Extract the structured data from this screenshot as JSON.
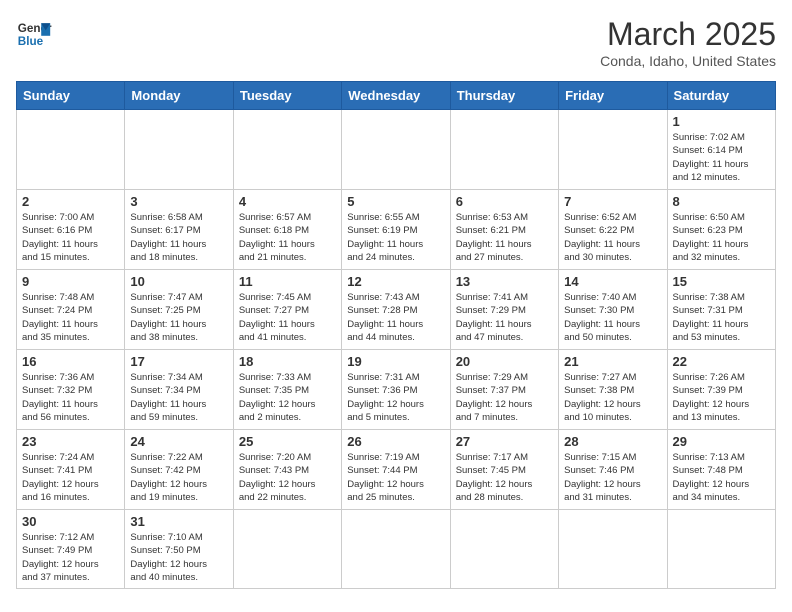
{
  "header": {
    "logo_line1": "General",
    "logo_line2": "Blue",
    "month_title": "March 2025",
    "location": "Conda, Idaho, United States"
  },
  "weekdays": [
    "Sunday",
    "Monday",
    "Tuesday",
    "Wednesday",
    "Thursday",
    "Friday",
    "Saturday"
  ],
  "weeks": [
    [
      {
        "day": "",
        "info": ""
      },
      {
        "day": "",
        "info": ""
      },
      {
        "day": "",
        "info": ""
      },
      {
        "day": "",
        "info": ""
      },
      {
        "day": "",
        "info": ""
      },
      {
        "day": "",
        "info": ""
      },
      {
        "day": "1",
        "info": "Sunrise: 7:02 AM\nSunset: 6:14 PM\nDaylight: 11 hours\nand 12 minutes."
      }
    ],
    [
      {
        "day": "2",
        "info": "Sunrise: 7:00 AM\nSunset: 6:16 PM\nDaylight: 11 hours\nand 15 minutes."
      },
      {
        "day": "3",
        "info": "Sunrise: 6:58 AM\nSunset: 6:17 PM\nDaylight: 11 hours\nand 18 minutes."
      },
      {
        "day": "4",
        "info": "Sunrise: 6:57 AM\nSunset: 6:18 PM\nDaylight: 11 hours\nand 21 minutes."
      },
      {
        "day": "5",
        "info": "Sunrise: 6:55 AM\nSunset: 6:19 PM\nDaylight: 11 hours\nand 24 minutes."
      },
      {
        "day": "6",
        "info": "Sunrise: 6:53 AM\nSunset: 6:21 PM\nDaylight: 11 hours\nand 27 minutes."
      },
      {
        "day": "7",
        "info": "Sunrise: 6:52 AM\nSunset: 6:22 PM\nDaylight: 11 hours\nand 30 minutes."
      },
      {
        "day": "8",
        "info": "Sunrise: 6:50 AM\nSunset: 6:23 PM\nDaylight: 11 hours\nand 32 minutes."
      }
    ],
    [
      {
        "day": "9",
        "info": "Sunrise: 7:48 AM\nSunset: 7:24 PM\nDaylight: 11 hours\nand 35 minutes."
      },
      {
        "day": "10",
        "info": "Sunrise: 7:47 AM\nSunset: 7:25 PM\nDaylight: 11 hours\nand 38 minutes."
      },
      {
        "day": "11",
        "info": "Sunrise: 7:45 AM\nSunset: 7:27 PM\nDaylight: 11 hours\nand 41 minutes."
      },
      {
        "day": "12",
        "info": "Sunrise: 7:43 AM\nSunset: 7:28 PM\nDaylight: 11 hours\nand 44 minutes."
      },
      {
        "day": "13",
        "info": "Sunrise: 7:41 AM\nSunset: 7:29 PM\nDaylight: 11 hours\nand 47 minutes."
      },
      {
        "day": "14",
        "info": "Sunrise: 7:40 AM\nSunset: 7:30 PM\nDaylight: 11 hours\nand 50 minutes."
      },
      {
        "day": "15",
        "info": "Sunrise: 7:38 AM\nSunset: 7:31 PM\nDaylight: 11 hours\nand 53 minutes."
      }
    ],
    [
      {
        "day": "16",
        "info": "Sunrise: 7:36 AM\nSunset: 7:32 PM\nDaylight: 11 hours\nand 56 minutes."
      },
      {
        "day": "17",
        "info": "Sunrise: 7:34 AM\nSunset: 7:34 PM\nDaylight: 11 hours\nand 59 minutes."
      },
      {
        "day": "18",
        "info": "Sunrise: 7:33 AM\nSunset: 7:35 PM\nDaylight: 12 hours\nand 2 minutes."
      },
      {
        "day": "19",
        "info": "Sunrise: 7:31 AM\nSunset: 7:36 PM\nDaylight: 12 hours\nand 5 minutes."
      },
      {
        "day": "20",
        "info": "Sunrise: 7:29 AM\nSunset: 7:37 PM\nDaylight: 12 hours\nand 7 minutes."
      },
      {
        "day": "21",
        "info": "Sunrise: 7:27 AM\nSunset: 7:38 PM\nDaylight: 12 hours\nand 10 minutes."
      },
      {
        "day": "22",
        "info": "Sunrise: 7:26 AM\nSunset: 7:39 PM\nDaylight: 12 hours\nand 13 minutes."
      }
    ],
    [
      {
        "day": "23",
        "info": "Sunrise: 7:24 AM\nSunset: 7:41 PM\nDaylight: 12 hours\nand 16 minutes."
      },
      {
        "day": "24",
        "info": "Sunrise: 7:22 AM\nSunset: 7:42 PM\nDaylight: 12 hours\nand 19 minutes."
      },
      {
        "day": "25",
        "info": "Sunrise: 7:20 AM\nSunset: 7:43 PM\nDaylight: 12 hours\nand 22 minutes."
      },
      {
        "day": "26",
        "info": "Sunrise: 7:19 AM\nSunset: 7:44 PM\nDaylight: 12 hours\nand 25 minutes."
      },
      {
        "day": "27",
        "info": "Sunrise: 7:17 AM\nSunset: 7:45 PM\nDaylight: 12 hours\nand 28 minutes."
      },
      {
        "day": "28",
        "info": "Sunrise: 7:15 AM\nSunset: 7:46 PM\nDaylight: 12 hours\nand 31 minutes."
      },
      {
        "day": "29",
        "info": "Sunrise: 7:13 AM\nSunset: 7:48 PM\nDaylight: 12 hours\nand 34 minutes."
      }
    ],
    [
      {
        "day": "30",
        "info": "Sunrise: 7:12 AM\nSunset: 7:49 PM\nDaylight: 12 hours\nand 37 minutes."
      },
      {
        "day": "31",
        "info": "Sunrise: 7:10 AM\nSunset: 7:50 PM\nDaylight: 12 hours\nand 40 minutes."
      },
      {
        "day": "",
        "info": ""
      },
      {
        "day": "",
        "info": ""
      },
      {
        "day": "",
        "info": ""
      },
      {
        "day": "",
        "info": ""
      },
      {
        "day": "",
        "info": ""
      }
    ]
  ]
}
